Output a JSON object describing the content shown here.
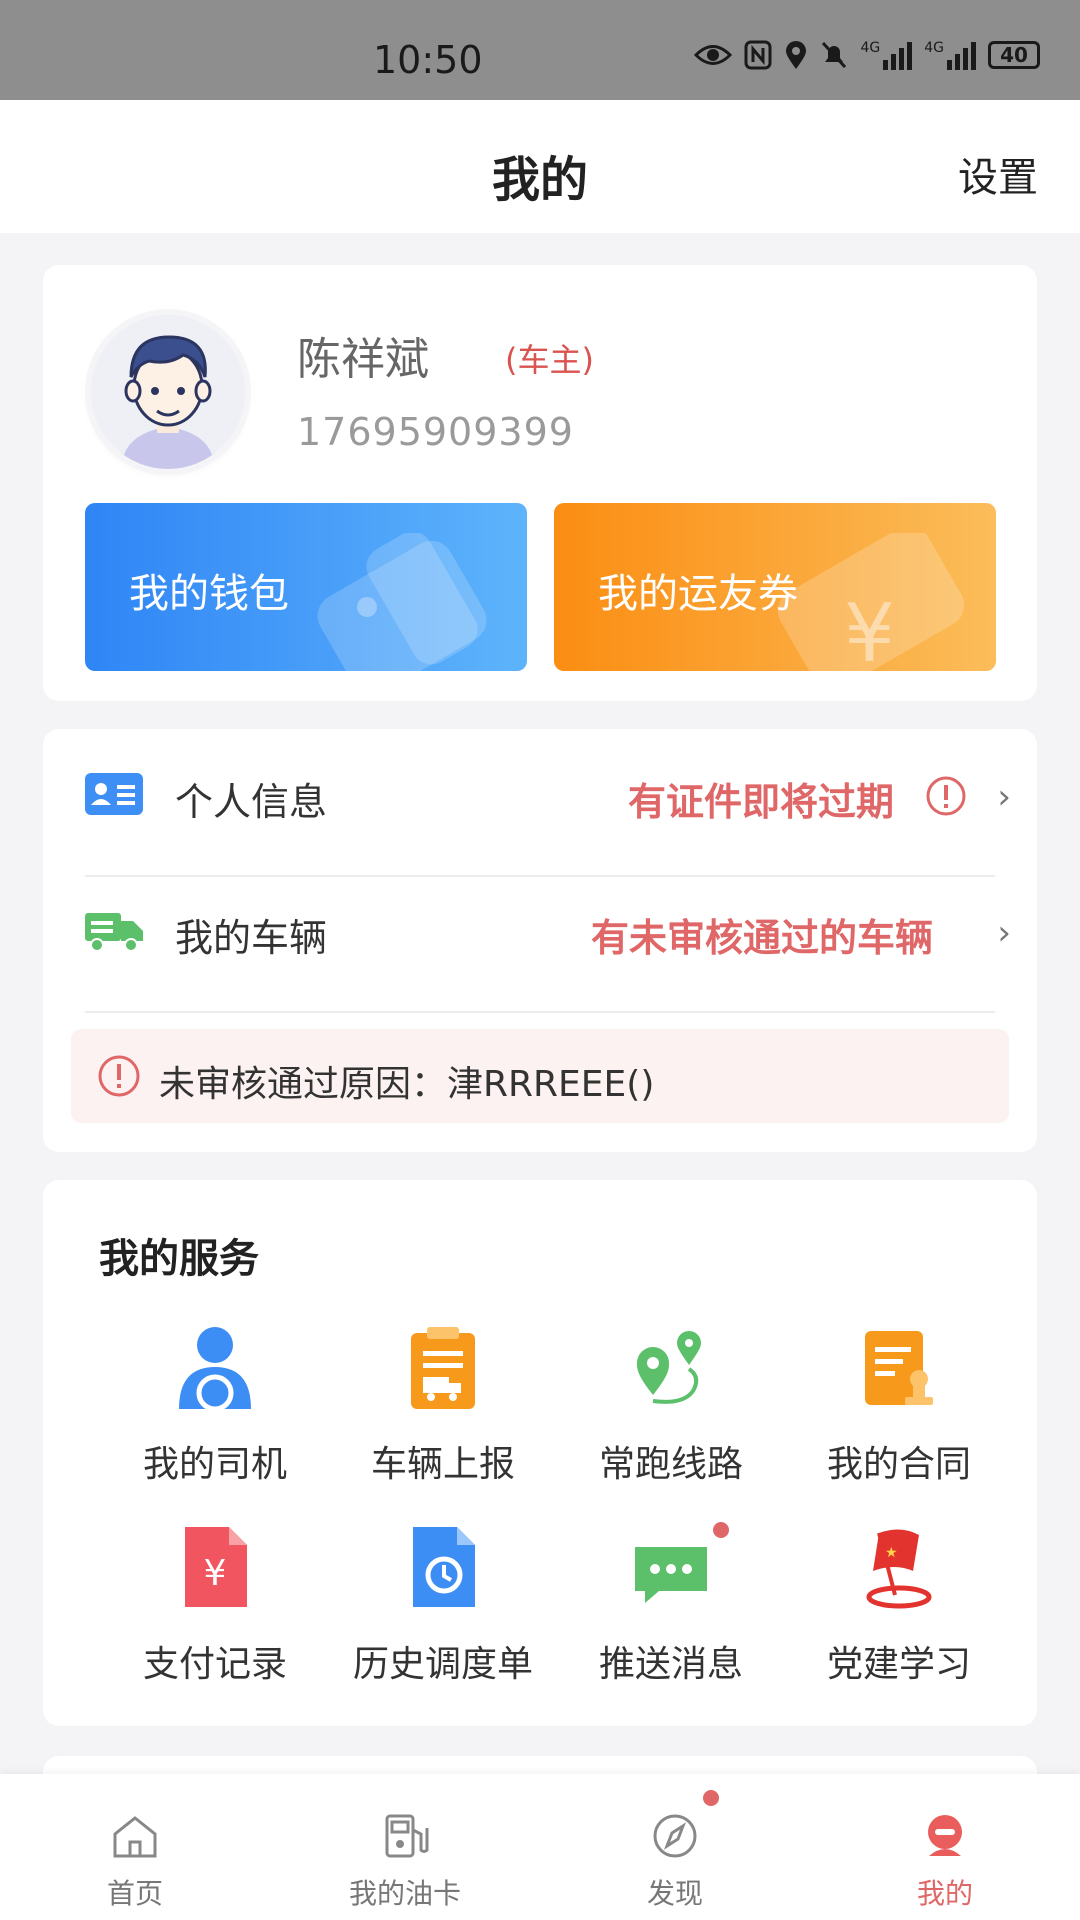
{
  "status_bar": {
    "time": "10:50",
    "network_1": "4G",
    "network_2": "4G",
    "battery": "40"
  },
  "header": {
    "title": "我的",
    "settings": "设置"
  },
  "profile": {
    "name": "陈祥斌",
    "role": "(车主)",
    "phone": "17695909399",
    "wallet_label": "我的钱包",
    "coupon_label": "我的运友券"
  },
  "info": {
    "personal_label": "个人信息",
    "personal_warning": "有证件即将过期",
    "vehicle_label": "我的车辆",
    "vehicle_warning": "有未审核通过的车辆",
    "reject_reason": "未审核通过原因：津RRREEE()"
  },
  "services": {
    "heading": "我的服务",
    "items": [
      {
        "label": "我的司机",
        "icon": "driver-icon"
      },
      {
        "label": "车辆上报",
        "icon": "vehicle-report-icon"
      },
      {
        "label": "常跑线路",
        "icon": "route-icon"
      },
      {
        "label": "我的合同",
        "icon": "contract-icon"
      },
      {
        "label": "支付记录",
        "icon": "payment-record-icon"
      },
      {
        "label": "历史调度单",
        "icon": "history-dispatch-icon"
      },
      {
        "label": "推送消息",
        "icon": "message-icon"
      },
      {
        "label": "党建学习",
        "icon": "party-flag-icon"
      }
    ]
  },
  "tabbar": {
    "items": [
      {
        "label": "首页",
        "icon": "home-icon"
      },
      {
        "label": "我的油卡",
        "icon": "fuel-card-icon"
      },
      {
        "label": "发现",
        "icon": "compass-icon"
      },
      {
        "label": "我的",
        "icon": "profile-icon"
      }
    ],
    "active_index": 3
  },
  "colors": {
    "accent": "#e06767",
    "wallet": "#2f85f5",
    "coupon": "#fb8d12"
  }
}
